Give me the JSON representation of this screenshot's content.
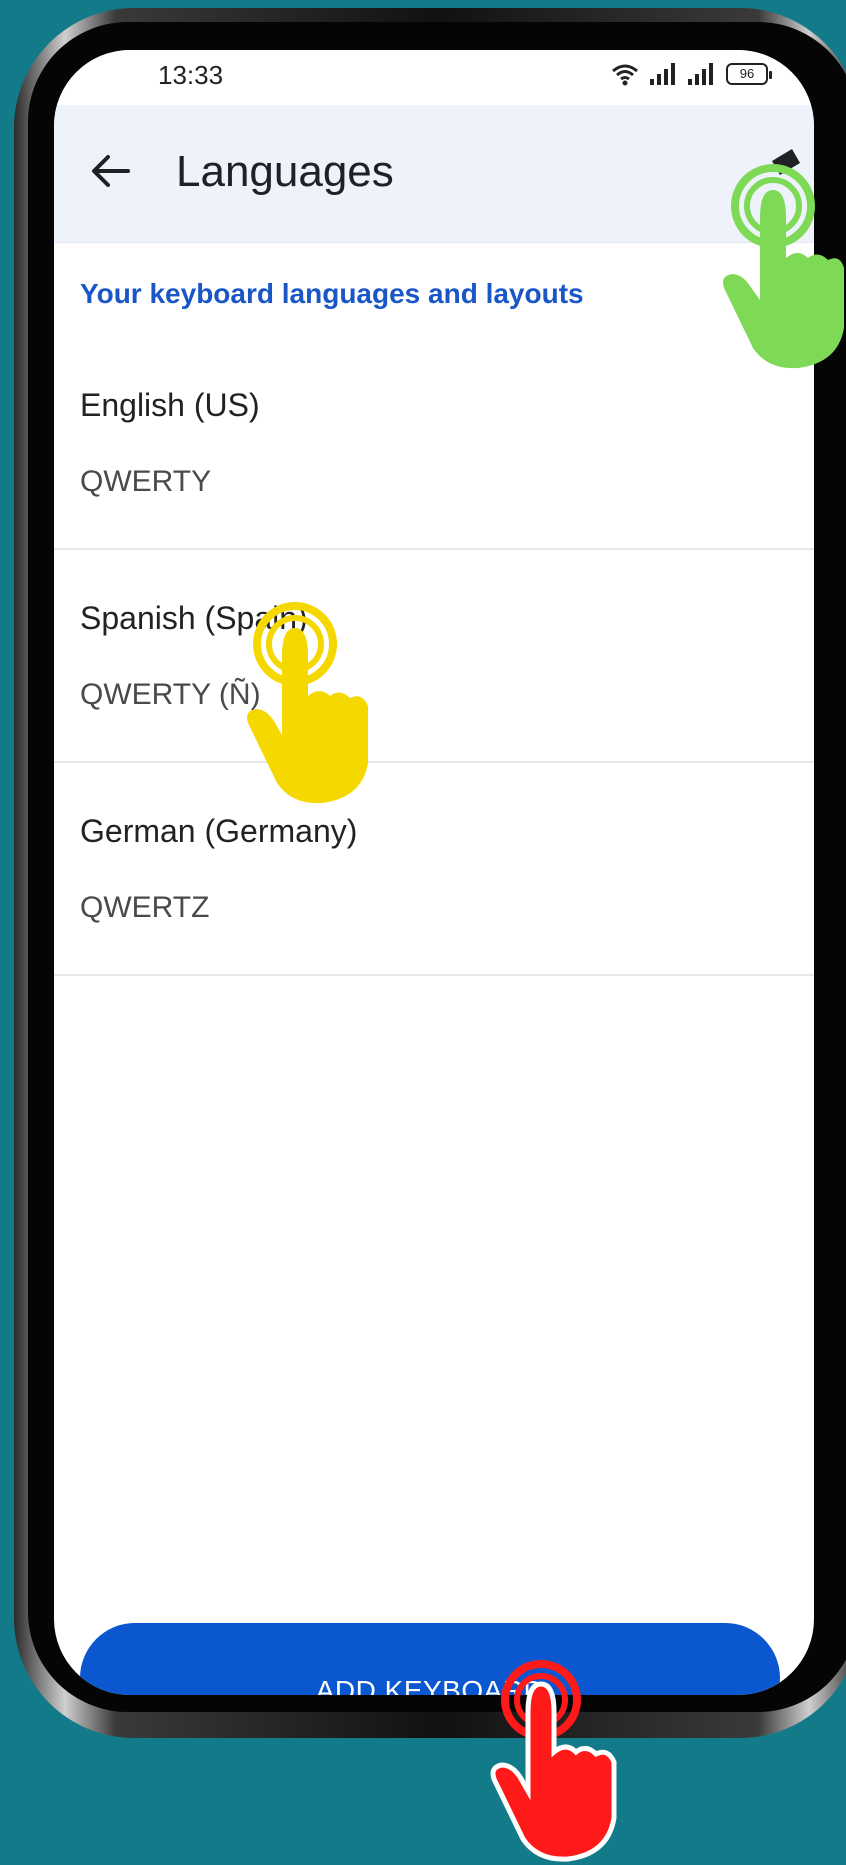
{
  "status_bar": {
    "time": "13:33",
    "battery": "96"
  },
  "app_bar": {
    "title": "Languages"
  },
  "section_header": "Your keyboard languages and layouts",
  "languages": [
    {
      "name": "English (US)",
      "layout": "QWERTY"
    },
    {
      "name": "Spanish (Spain)",
      "layout": "QWERTY (Ñ)"
    },
    {
      "name": "German (Germany)",
      "layout": "QWERTZ"
    }
  ],
  "add_keyboard_label": "ADD KEYBOARD",
  "colors": {
    "background": "#127a89",
    "accent": "#0b57d0",
    "section_header": "#1a56c8",
    "app_bar": "#eef3fb",
    "hand_green": "#7ed957",
    "hand_yellow": "#f5d800",
    "hand_red": "#ff1a1a"
  }
}
